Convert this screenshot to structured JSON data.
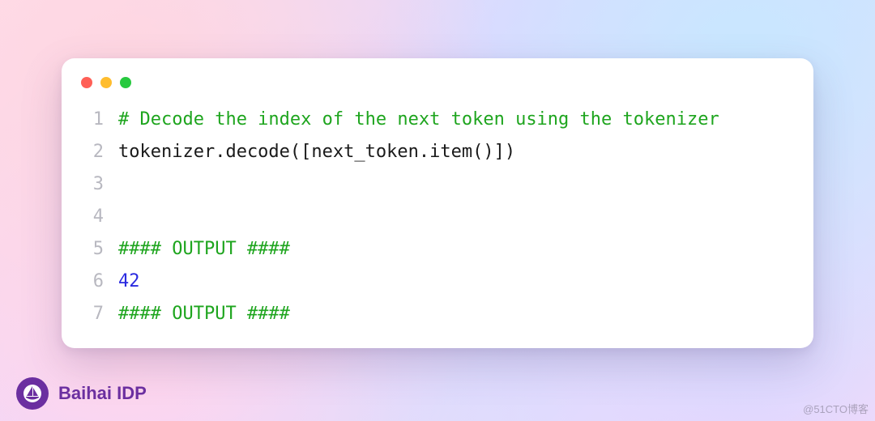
{
  "code": {
    "lines": [
      {
        "n": "1",
        "spans": [
          {
            "cls": "c-comment",
            "text": "# Decode the index of the next token using the tokenizer"
          }
        ]
      },
      {
        "n": "2",
        "spans": [
          {
            "cls": "c-plain",
            "text": "tokenizer.decode([next_token.item()])"
          }
        ]
      },
      {
        "n": "3",
        "spans": [
          {
            "cls": "c-plain",
            "text": ""
          }
        ]
      },
      {
        "n": "4",
        "spans": [
          {
            "cls": "c-plain",
            "text": ""
          }
        ]
      },
      {
        "n": "5",
        "spans": [
          {
            "cls": "c-comment",
            "text": "#### OUTPUT ####"
          }
        ]
      },
      {
        "n": "6",
        "spans": [
          {
            "cls": "c-number",
            "text": "42"
          }
        ]
      },
      {
        "n": "7",
        "spans": [
          {
            "cls": "c-comment",
            "text": "#### OUTPUT ####"
          }
        ]
      }
    ]
  },
  "brand": {
    "name": "Baihai IDP"
  },
  "watermark": "@51CTO博客",
  "traffic": {
    "red": "close",
    "yellow": "minimize",
    "green": "zoom"
  }
}
